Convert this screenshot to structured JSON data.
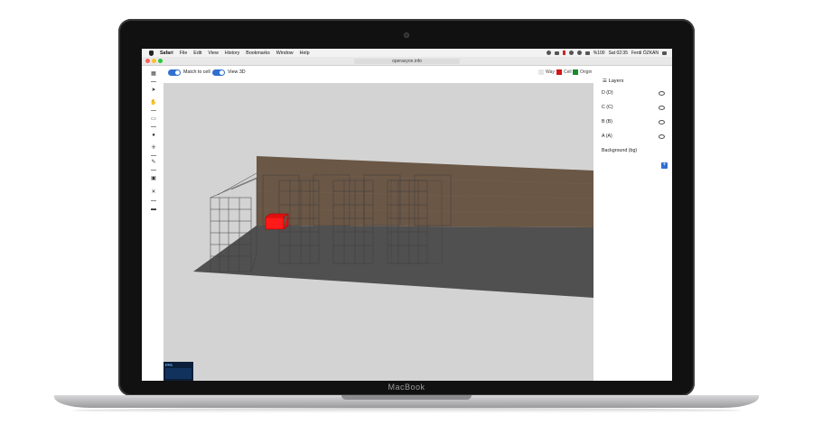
{
  "device": {
    "brand_label": "MacBook"
  },
  "menubar": {
    "items": [
      "Safari",
      "File",
      "Edit",
      "View",
      "History",
      "Bookmarks",
      "Window",
      "Help"
    ],
    "clock": "Sat 02:35",
    "user": "Ferdi ÖZKAN",
    "battery": "%100"
  },
  "browser": {
    "url": "operasyon.info"
  },
  "app_toolbar": {
    "toggles": [
      {
        "label": "Match to cell",
        "on": true
      },
      {
        "label": "View 3D",
        "on": true
      }
    ],
    "legend": [
      {
        "label": "Way",
        "color": "#e6e6e6"
      },
      {
        "label": "Cell",
        "color": "#d01818"
      },
      {
        "label": "Origin",
        "color": "#1a8a2e"
      }
    ]
  },
  "layers": {
    "title": "Layers",
    "items": [
      {
        "label": "D (D)",
        "visible": true
      },
      {
        "label": "C (C)",
        "visible": true
      },
      {
        "label": "B (B)",
        "visible": true
      },
      {
        "label": "A (A)",
        "visible": true
      },
      {
        "label": "Background (bg)",
        "visible": false
      }
    ],
    "add_label": "+"
  },
  "stats": {
    "label": "FPS"
  },
  "colors": {
    "accent": "#2f6fd0",
    "wall": "#6b5746",
    "floor": "#505050",
    "selected_cell": "#ff1a1a"
  }
}
